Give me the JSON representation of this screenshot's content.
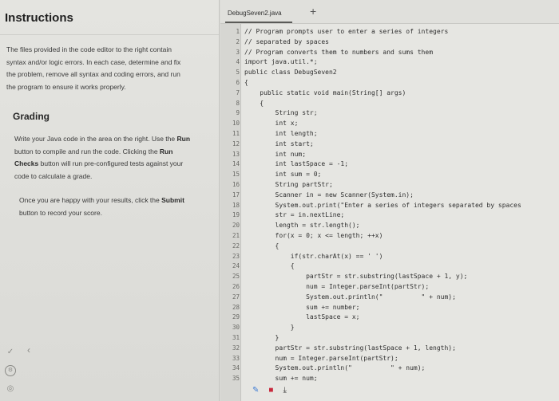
{
  "instructions": {
    "title": "Instructions",
    "para1": [
      "The files provided in the code editor to the right contain",
      "syntax and/or logic errors. In each case, determine and fix",
      "the problem, remove all syntax and coding errors, and run",
      "the program to ensure it works properly."
    ],
    "grading_title": "Grading",
    "grading_lines": [
      [
        "Write your Java code in the area on the right. Use the ",
        "Run",
        ""
      ],
      [
        "button to compile and run the code. Clicking the ",
        "Run",
        ""
      ],
      [
        "",
        "Checks",
        " button will run pre-configured tests against your"
      ],
      [
        "code to calculate a grade.",
        "",
        ""
      ]
    ],
    "submit_lines": [
      [
        "Once you are happy with your results, click the ",
        "Submit",
        ""
      ],
      [
        "button to record your score.",
        "",
        ""
      ]
    ]
  },
  "editor": {
    "tab_name": "DebugSeven2.java",
    "add_tab": "+",
    "line_numbers": [
      "1",
      "2",
      "3",
      "4",
      "5",
      "6",
      "7",
      "8",
      "9",
      "10",
      "11",
      "12",
      "13",
      "14",
      "15",
      "16",
      "17",
      "18",
      "19",
      "20",
      "21",
      "22",
      "23",
      "24",
      "25",
      "26",
      "27",
      "28",
      "29",
      "30",
      "31",
      "32",
      "33",
      "34",
      "35"
    ],
    "code_lines": [
      "// Program prompts user to enter a series of integers",
      "// separated by spaces",
      "// Program converts them to numbers and sums them",
      "import java.util.*;",
      "public class DebugSeven2",
      "{",
      "    public static void main(String[] args)",
      "    {",
      "        String str;",
      "        int x;",
      "        int length;",
      "        int start;",
      "        int num;",
      "        int lastSpace = -1;",
      "        int sum = 0;",
      "        String partStr;",
      "        Scanner in = new Scanner(System.in);",
      "        System.out.print(\"Enter a series of integers separated by spaces",
      "        str = in.nextLine;",
      "        length = str.length();",
      "        for(x = 0; x <= length; ++x)",
      "        {",
      "            if(str.charAt(x) == ' ')",
      "            {",
      "                partStr = str.substring(lastSpace + 1, y);",
      "                num = Integer.parseInt(partStr);",
      "                System.out.println(\"          \" + num);",
      "                sum += number;",
      "                lastSpace = x;",
      "            }",
      "        }",
      "        partStr = str.substring(lastSpace + 1, length);",
      "        num = Integer.parseInt(partStr);",
      "        System.out.println(\"          \" + num);",
      "        sum += num;"
    ]
  },
  "sidebar_icons": [
    "collapse-chevron",
    "settings-icon",
    "circle-icon"
  ],
  "bottom_toolbar": [
    "pen-icon",
    "record-icon",
    "download-icon"
  ],
  "glyphs": {
    "collapse": "‹",
    "settings": "⚙",
    "circle": "◎",
    "pen": "✎",
    "record": "■",
    "download": "⤓"
  }
}
